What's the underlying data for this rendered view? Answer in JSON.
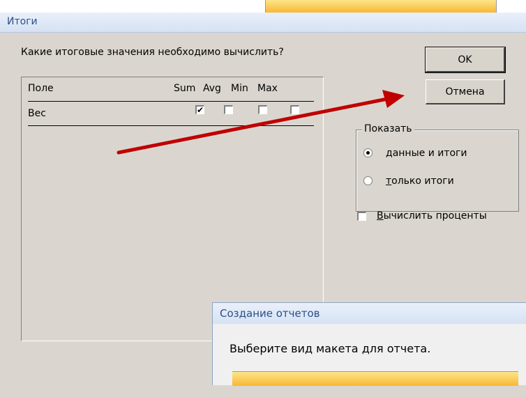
{
  "dialog": {
    "title": "Итоги",
    "question": "Какие итоговые значения необходимо вычислить?",
    "table": {
      "headers": [
        "Поле",
        "Sum",
        "Avg",
        "Min",
        "Max"
      ],
      "rows": [
        {
          "field": "Вес",
          "sum": true,
          "avg": false,
          "min": false,
          "max": false
        }
      ]
    },
    "ok_label": "OK",
    "cancel_label": "Отмена",
    "show_group": {
      "legend": "Показать",
      "options": [
        {
          "label_first": "д",
          "label_rest": "анные и итоги",
          "selected": true
        },
        {
          "label_first": "т",
          "label_rest": "олько итоги",
          "selected": false
        }
      ]
    },
    "percent_checkbox": {
      "label_first": "В",
      "label_rest": "ычислить проценты",
      "checked": false
    }
  },
  "subdialog": {
    "title": "Создание отчетов",
    "text": "Выберите вид макета для отчета."
  },
  "colors": {
    "arrow": "#c00000",
    "titlebar_text": "#2d4f86"
  }
}
